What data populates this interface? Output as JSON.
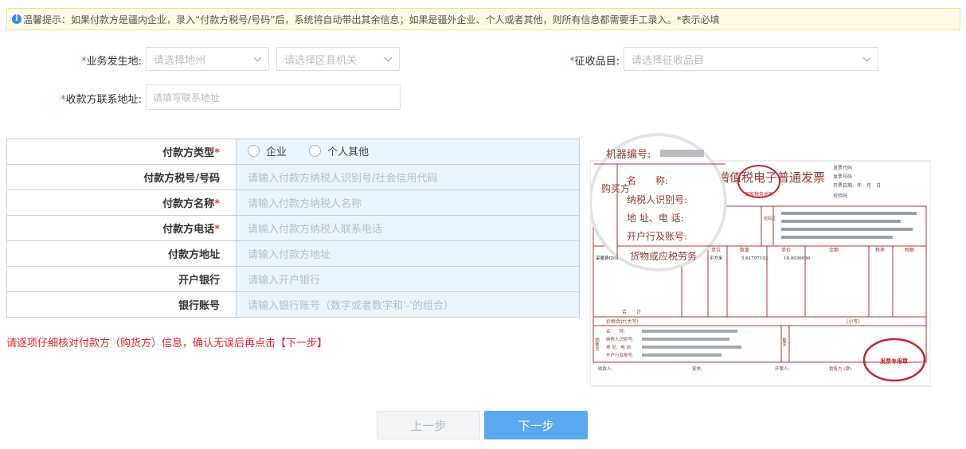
{
  "notice": {
    "text": "温馨提示：如果付款方是疆内企业，录入“付款方税号/号码”后，系统将自动带出其余信息；如果是疆外企业、个人或者其他，则所有信息都需要手工录入。*表示必填"
  },
  "filters": {
    "business_location": {
      "label": "业务发生地:",
      "city_placeholder": "请选择地州",
      "district_placeholder": "请选择区县机关"
    },
    "collection_item": {
      "label": "征收品目:",
      "placeholder": "请选择征收品目"
    },
    "payee_address": {
      "label": "收款方联系地址:",
      "placeholder": "请填写联系地址"
    }
  },
  "payer_form": {
    "rows": [
      {
        "label": "付款方类型",
        "required": true,
        "type": "radio",
        "options": [
          "企业",
          "个人其他"
        ]
      },
      {
        "label": "付款方税号/号码",
        "required": false,
        "placeholder": "请输入付款方纳税人识别号/社会信用代码"
      },
      {
        "label": "付款方名称",
        "required": true,
        "placeholder": "请输入付款方纳税人名称"
      },
      {
        "label": "付款方电话",
        "required": true,
        "placeholder": "请输入付款方纳税人联系电话"
      },
      {
        "label": "付款方地址",
        "required": false,
        "placeholder": "请输入付款方地址"
      },
      {
        "label": "开户银行",
        "required": false,
        "placeholder": "请输入开户银行"
      },
      {
        "label": "银行账号",
        "required": false,
        "placeholder": "请输入银行账号（数字或者数字和'-'的组合）"
      }
    ]
  },
  "warning": "请逐项仔细核对付款方（购货方）信息，确认无误后再点击【下一步】",
  "sample_invoice": {
    "title": "增值税电子普通发票",
    "machine_no": "机器编号:",
    "buyer_side": "购买方",
    "buyer_fields": [
      "名　　称:",
      "纳税人识别号:",
      "地 址、电 话:",
      "开户行及账号:"
    ],
    "goods_header": "货物或应税劳务",
    "code_fields": [
      "发票代码",
      "发票号码",
      "开票日期:",
      "校验码"
    ],
    "year_month_day": "年　月　日",
    "password_area": "密码区",
    "item_row": [
      "采暖费(2018",
      "平方米",
      "5.61797192",
      "16.0036036"
    ],
    "columns": [
      "单位",
      "数量",
      "单价",
      "金额",
      "税率",
      "税额"
    ],
    "subtotal": "合　　计",
    "total_in_words": "价税合计(大写)",
    "total_small": "(小写)",
    "seller_side": "销售方",
    "seller_fields": [
      "名　　称:",
      "纳税人识别号:",
      "地 址、电 话:",
      "开户行及账号:"
    ],
    "remarks": "备注",
    "footer": [
      "收款人:",
      "复核:",
      "开票人:",
      "销售方:(章)"
    ],
    "stamp_text": "发票专用章",
    "top_stamp": "国家税务总局"
  },
  "buttons": {
    "prev": "上一步",
    "next": "下一步"
  },
  "colors": {
    "required": "#e4393c",
    "warning": "#e4202e",
    "primary": "#5aa9f0",
    "table_cell_bg": "#eaf4fd",
    "notice_bg": "#fdfbe6"
  }
}
